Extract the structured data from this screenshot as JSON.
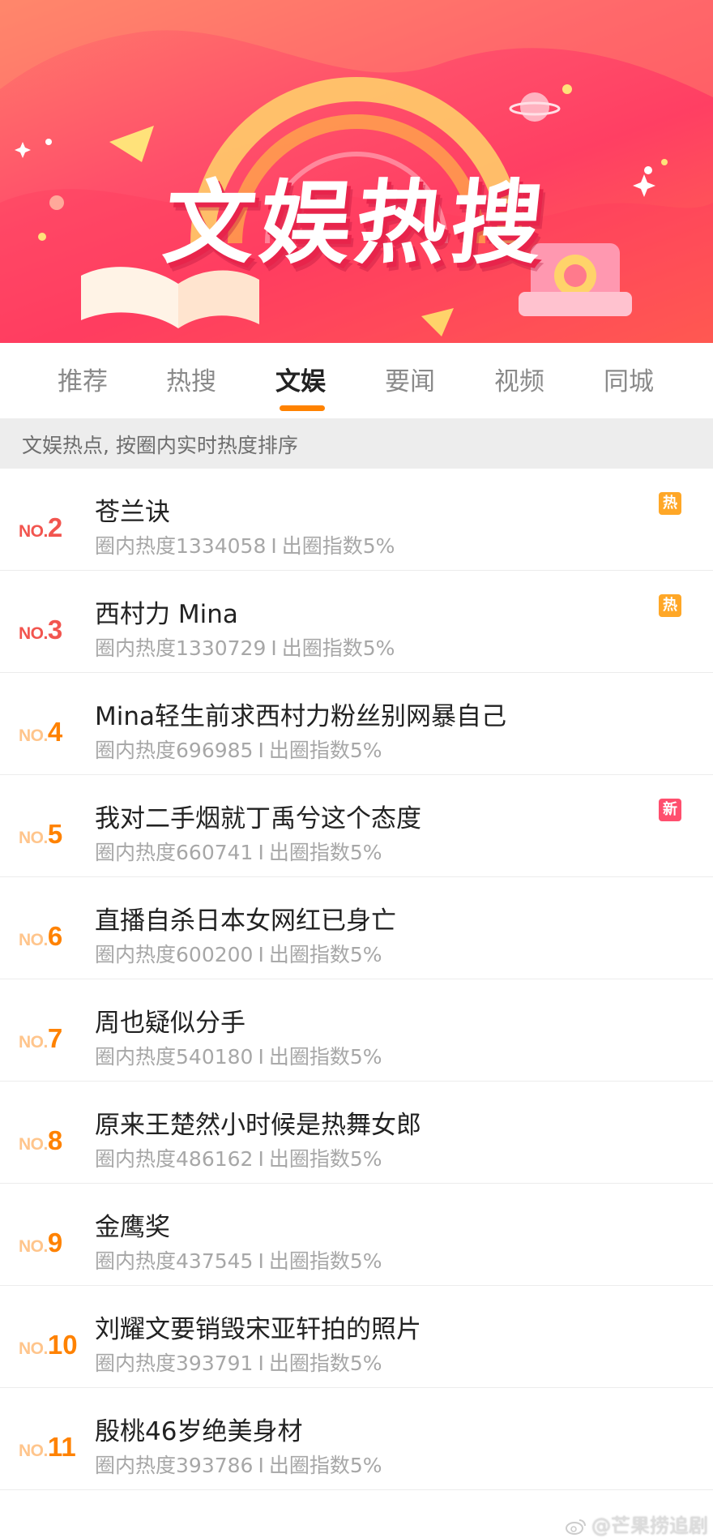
{
  "banner": {
    "title": "文娱热搜"
  },
  "tabs": [
    {
      "label": "推荐"
    },
    {
      "label": "热搜"
    },
    {
      "label": "文娱"
    },
    {
      "label": "要闻"
    },
    {
      "label": "视频"
    },
    {
      "label": "同城"
    }
  ],
  "active_tab": "文娱",
  "subtitle": "文娱热点, 按圈内实时热度排序",
  "rank_prefix": "NO.",
  "meta_labels": {
    "heat": "圈内热度",
    "separator": "I",
    "index": "出圈指数5%"
  },
  "items": [
    {
      "rank": "2",
      "title": "苍兰诀",
      "heat": "1334058",
      "badge": "热"
    },
    {
      "rank": "3",
      "title": "西村力 Mina",
      "heat": "1330729",
      "badge": "热"
    },
    {
      "rank": "4",
      "title": "Mina轻生前求西村力粉丝别网暴自己",
      "heat": "696985",
      "badge": ""
    },
    {
      "rank": "5",
      "title": "我对二手烟就丁禹兮这个态度",
      "heat": "660741",
      "badge": "新"
    },
    {
      "rank": "6",
      "title": "直播自杀日本女网红已身亡",
      "heat": "600200",
      "badge": ""
    },
    {
      "rank": "7",
      "title": "周也疑似分手",
      "heat": "540180",
      "badge": ""
    },
    {
      "rank": "8",
      "title": "原来王楚然小时候是热舞女郎",
      "heat": "486162",
      "badge": ""
    },
    {
      "rank": "9",
      "title": "金鹰奖",
      "heat": "437545",
      "badge": ""
    },
    {
      "rank": "10",
      "title": "刘耀文要销毁宋亚轩拍的照片",
      "heat": "393791",
      "badge": ""
    },
    {
      "rank": "11",
      "title": "殷桃46岁绝美身材",
      "heat": "393786",
      "badge": ""
    }
  ],
  "watermark": "@芒果捞追剧",
  "colors": {
    "accent": "#ff8200",
    "rank_top": "#f2554f",
    "badge_hot": "#ffa727",
    "badge_new": "#ff4f6e"
  }
}
